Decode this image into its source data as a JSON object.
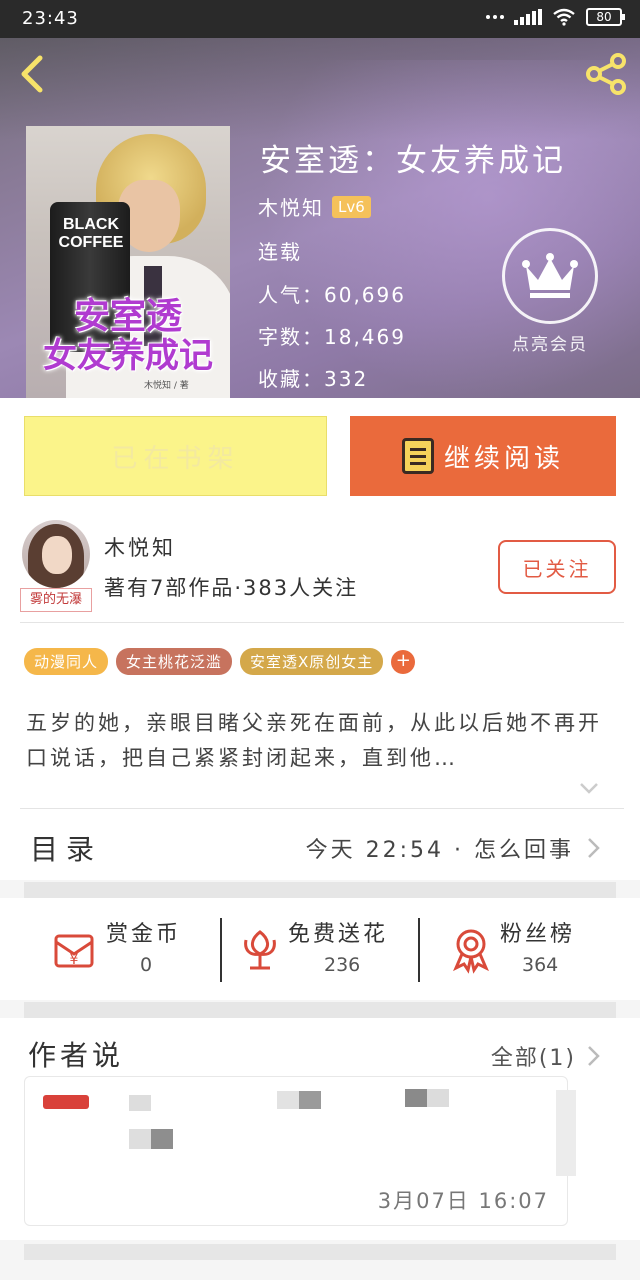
{
  "status_bar": {
    "time": "23:43",
    "battery": "80"
  },
  "book": {
    "title": "安室透：女友养成记",
    "author": "木悦知",
    "level": "Lv6",
    "status": "连载",
    "popularity": "人气：60,696",
    "word_count": "字数：18,469",
    "favorites": "收藏：332",
    "vip_label": "点亮会员"
  },
  "cover": {
    "can_text": "BLACK\nCOFFEE",
    "title_line1": "安室透",
    "title_line2": "女友养成记",
    "author_small": "木悦知 / 著"
  },
  "actions": {
    "shelf_label": "已在书架",
    "read_label": "继续阅读"
  },
  "author_info": {
    "name": "木悦知",
    "stats": "著有7部作品·383人关注",
    "follow_label": "已关注",
    "avatar_tag": "雾的无瀑"
  },
  "tags": [
    {
      "label": "动漫同人",
      "color": "#f5b74a"
    },
    {
      "label": "女主桃花泛滥",
      "color": "#c7735e"
    },
    {
      "label": "安室透X原创女主",
      "color": "#d4a84a"
    }
  ],
  "tag_plus": "+",
  "description": "五岁的她，亲眼目睹父亲死在面前，从此以后她不再开口说话，把自己紧紧封闭起来，直到他…",
  "catalog": {
    "label": "目录",
    "latest": "今天 22:54 · 怎么回事"
  },
  "stats": {
    "reward": {
      "label": "赏金币",
      "value": "0"
    },
    "flowers": {
      "label": "免费送花",
      "value": "236"
    },
    "fans": {
      "label": "粉丝榜",
      "value": "364"
    }
  },
  "author_says": {
    "label": "作者说",
    "all": "全部(1)",
    "date": "3月07日  16:07"
  },
  "colors": {
    "accent": "#ea6a3c",
    "shelf": "#fbf48a",
    "follow": "#e25b44",
    "icon_red": "#d94a3a"
  }
}
